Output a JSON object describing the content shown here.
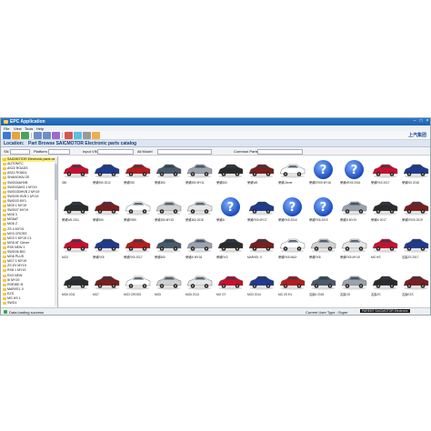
{
  "window": {
    "title": "EPC Application",
    "brand": "上汽集团"
  },
  "menu": [
    "File",
    "View",
    "Tools",
    "Help"
  ],
  "location": {
    "label": "Location:",
    "path": "Part Browse  SAICMOTOR Electronic parts catalog"
  },
  "filters": {
    "col1": "SN",
    "col2": "Platform",
    "col3": "Input VIN",
    "col4": "All Model",
    "col5": "Common Parts"
  },
  "sidebar": {
    "items": [
      "SAICMOTOR Electronic parts catalo",
      "AUTOMTC",
      "AS22 ROADS",
      "AS11 ROAD1",
      "SHANGHAI ZE",
      "SWG04AHVB",
      "SWG03AV3 1 MY19",
      "SWG030HVB 2 MY19",
      "SWG05 HVB 1 MY19",
      "SWG03 MY1",
      "MG5 1 MY19",
      "SWG07 MY19",
      "MG6 3",
      "MG6AT",
      "MG6 Z",
      "ZS 4 MY19",
      "MG3 CROSS",
      "MG3 1 MY19 CL",
      "MG5 AT Clever",
      "RX5 NEW 1",
      "SWG06 BIG",
      "MG6 PLUS",
      "MG7 1 MY19",
      "ZS EV MY19",
      "RX8 1 MY19",
      "RX3 NEW",
      "I6 MY19",
      "ROEWE i5",
      "MARVEL X",
      "EZS",
      "MG HS 1",
      "SWG1"
    ]
  },
  "grid": {
    "rows": [
      [
        "350",
        "荣威950 2012",
        "荣威E50",
        "荣威360",
        "荣威550 MY11",
        "荣威550",
        "荣威W5",
        "荣威Clever",
        "荣威ERX5 MY18",
        "荣威eRX5 2016",
        "荣威RX3 2017",
        "荣威Ei5 2018"
      ],
      [
        "荣威W5 2011",
        "荣威950",
        "荣威E950",
        "荣威350 MY15",
        "荣威360 2018",
        "荣威i6",
        "荣威RX5 MY17",
        "荣威RX5 2016",
        "荣威RX8 2019",
        "荣威i5 MY19",
        "荣威i6 2017",
        "荣威ERX5 2019"
      ],
      [
        "MG3",
        "荣威RX5",
        "荣威RX5 2017",
        "荣威550",
        "荣威i6 MY18",
        "荣威RX3",
        "MARVEL X",
        "荣威RX5 MAX",
        "荣威RX8",
        "荣威RX5 MY19",
        "MG HS",
        "名爵ZS 2017"
      ],
      [
        "MG6 2011",
        "MG7",
        "MG3 CROSS",
        "MG5",
        "MG6 2013",
        "MG GT",
        "MG3 2014",
        "MG ZS EV",
        "名爵6 2018",
        "名爵GS",
        "名爵ZS",
        "名爵EZS"
      ]
    ]
  },
  "status": {
    "left": "Data loading success",
    "mid": "Current User Type : Super",
    "right": "PARENT SAICMOTOR Electronic"
  },
  "colors": {
    "accent": "#1d62b0",
    "selection": "#ffef7a"
  }
}
